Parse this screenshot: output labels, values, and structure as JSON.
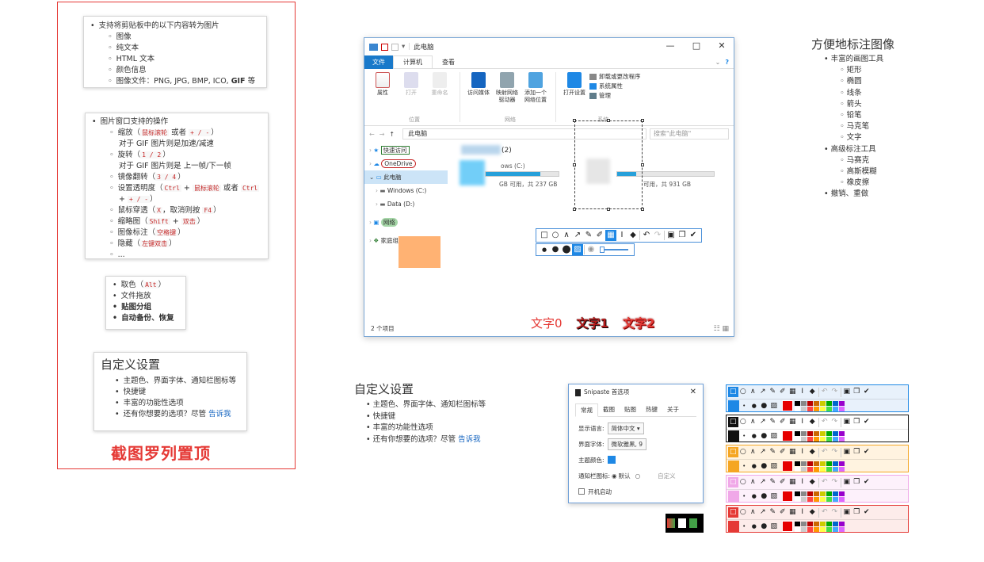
{
  "feature_cards": {
    "clipboard": {
      "heading": "支持将剪贴板中的以下内容转为图片",
      "items": [
        "图像",
        "纯文本",
        "HTML 文本",
        "颜色信息",
        "图像文件：PNG, JPG, BMP, ICO, "
      ],
      "gif_label": "GIF",
      "gif_suffix": " 等"
    },
    "window_ops": {
      "heading": "图片窗口支持的操作",
      "zoom": "缩放（",
      "zoom_k1": "鼠标滚轮",
      "zoom_or": " 或者 ",
      "zoom_k2": "+ / -",
      "zoom_end": "）",
      "zoom_note": "对于 GIF 图片则是加速/减速",
      "rotate": "旋转（",
      "rotate_k": "1 / 2",
      "rotate_end": "）",
      "rotate_note": "对于 GIF 图片则是 上一帧/下一帧",
      "mirror": "镜像翻转（",
      "mirror_k": "3 / 4",
      "mirror_end": "）",
      "opacity": "设置透明度（",
      "opacity_k1": "Ctrl",
      "opacity_plus": " + ",
      "opacity_k2": "鼠标滚轮",
      "opacity_or": " 或者 ",
      "opacity_k3": "Ctrl",
      "opacity_line2_plus": "+ ",
      "opacity_k4": "+ / -",
      "opacity_end": "）",
      "passthrough": "鼠标穿透（",
      "passthrough_k1": "X",
      "passthrough_mid": "，取消则按 ",
      "passthrough_k2": "F4",
      "passthrough_end": "）",
      "thumb": "缩略图（",
      "thumb_k1": "Shift",
      "thumb_plus": " + ",
      "thumb_k2": "双击",
      "thumb_end": "）",
      "annotate": "图像标注（",
      "annotate_k": "空格键",
      "annotate_end": "）",
      "hide": "隐藏（",
      "hide_k": "左键双击",
      "hide_end": "）",
      "more": "..."
    },
    "misc": {
      "pick": "取色（",
      "pick_k": "Alt",
      "pick_end": "）",
      "drag": "文件拖放",
      "group": "贴图分组",
      "backup": "自动备份、恢复"
    },
    "custom": {
      "title": "自定义设置",
      "items": [
        "主题色、界面字体、通知栏图标等",
        "快捷键",
        "丰富的功能性选项"
      ],
      "ask": "还有你想要的选项？尽管 ",
      "ask_link": "告诉我"
    }
  },
  "red_title": "截图罗列置顶",
  "explorer": {
    "title": "此电脑",
    "tabs": [
      "文件",
      "计算机",
      "查看"
    ],
    "ribbon": {
      "props": "属性",
      "open": "打开",
      "rename": "重命名",
      "location_group": "位置",
      "media": "访问媒体",
      "map_drive": "映射网络驱动器",
      "add_location": "添加一个网络位置",
      "network_group": "网络",
      "open_settings": "打开设置",
      "uninstall": "卸载或更改程序",
      "sys_props": "系统属性",
      "manage": "管理",
      "system_group": "系统"
    },
    "address": "此电脑",
    "search": "搜索\"此电脑\"",
    "nav": [
      "快速访问",
      "OneDrive",
      "此电脑",
      "Windows (C:)",
      "Data (D:)",
      "网络",
      "家庭组"
    ],
    "devices_header": "(2)",
    "drive_c_label": "ows (C:)",
    "drive_c_free": "GB 可用，共 237 GB",
    "drive_d_free": "可用，共 931 GB",
    "status": "2 个项目",
    "colors": {
      "accent": "#1979ca"
    }
  },
  "text_samples": [
    "文字0",
    "文字1",
    "文字2"
  ],
  "right_list": {
    "title": "方便地标注图像",
    "basic": "丰富的画图工具",
    "basic_items": [
      "矩形",
      "椭圆",
      "线条",
      "箭头",
      "铅笔",
      "马克笔",
      "文字"
    ],
    "advanced": "高级标注工具",
    "advanced_items": [
      "马赛克",
      "高斯模糊",
      "橡皮擦"
    ],
    "undo": "撤销、重做"
  },
  "settings_section": {
    "title": "自定义设置",
    "items": [
      "主题色、界面字体、通知栏图标等",
      "快捷键",
      "丰富的功能性选项"
    ],
    "ask": "还有你想要的选项？尽管 ",
    "ask_link": "告诉我"
  },
  "dialog": {
    "title": "Snipaste 首选项",
    "tabs": [
      "常规",
      "截图",
      "贴图",
      "热键",
      "关于"
    ],
    "lang_label": "显示语言:",
    "lang_value": "简体中文",
    "font_label": "界面字体:",
    "font_value": "微软雅黑, 9",
    "theme_label": "主题颜色:",
    "theme_color": "#1e88e5",
    "tray_label": "通知栏图标:",
    "tray_default": "默认",
    "tray_custom": "自定义",
    "startup": "开机启动"
  },
  "toolbar_themes": [
    "#1e88e5",
    "#111111",
    "#f5a623",
    "#f0a8e8",
    "#e53935"
  ]
}
